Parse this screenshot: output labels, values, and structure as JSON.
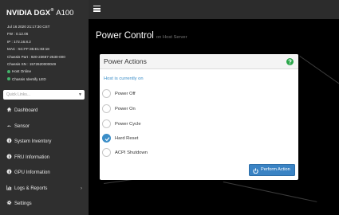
{
  "brand": {
    "name": "NVIDIA DGX",
    "trademark": "®",
    "model": "A100"
  },
  "system_info": {
    "datetime": "Jul 16 2020 21:17:30 CST",
    "fw": "FW : 0.12.06",
    "ip": "IP : 172.16.8.2",
    "mac": "MAC : 5C:FF:35:E1:83:18",
    "chassis_part": "Chassis Part : 920-23687-2530-000",
    "chassis_sn": "Chassis SN : 1572620000049",
    "host_status": "Host Online",
    "led_status": "Chassis Identify LED",
    "status_color": "#43b36a"
  },
  "quick_links": {
    "placeholder": "Quick Links..."
  },
  "nav": {
    "dashboard": "Dashboard",
    "sensor": "Sensor",
    "system_inventory": "System Inventory",
    "fru_information": "FRU Information",
    "gpu_information": "GPU Information",
    "logs_reports": "Logs & Reports",
    "settings": "Settings"
  },
  "page": {
    "title": "Power Control",
    "subtitle": "on Host Server"
  },
  "panel": {
    "title": "Power Actions",
    "status": "Host is currently on",
    "options": [
      "Power Off",
      "Power On",
      "Power Cycle",
      "Hard Reset",
      "ACPI Shutdown"
    ],
    "selected_option": "Hard Reset",
    "button": "Perform Action"
  },
  "colors": {
    "accent": "#3b8ec8",
    "sidebar_bg": "#2f2f2f",
    "topbar_bg": "#2c2c2c",
    "help_green": "#2aa64a"
  }
}
